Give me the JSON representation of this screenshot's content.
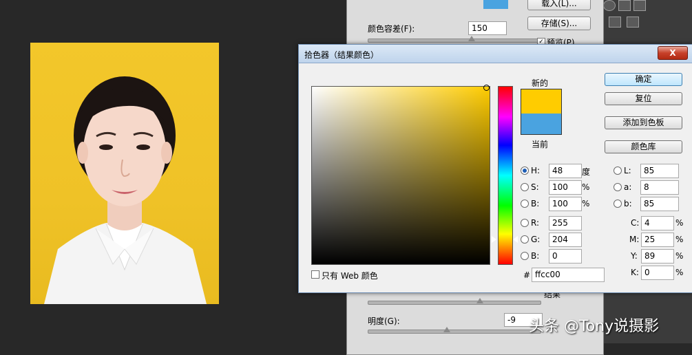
{
  "bg_panel": {
    "load_button": "载入(L)...",
    "save_button": "存储(S)...",
    "tolerance_label": "颜色容差(F):",
    "tolerance_value": "150",
    "preview_label": "预览(P)",
    "result_label": "结果",
    "lightness_label": "明度(G):",
    "lightness_value": "-9"
  },
  "dialog": {
    "title": "拾色器（结果颜色）",
    "close_label": "X",
    "new_label": "新的",
    "current_label": "当前",
    "buttons": {
      "ok": "确定",
      "reset": "复位",
      "add_swatch": "添加到色板",
      "libraries": "颜色库"
    },
    "hsb": [
      {
        "label": "H:",
        "value": "48",
        "unit": "度",
        "selected": true
      },
      {
        "label": "S:",
        "value": "100",
        "unit": "%",
        "selected": false
      },
      {
        "label": "B:",
        "value": "100",
        "unit": "%",
        "selected": false
      }
    ],
    "rgb": [
      {
        "label": "R:",
        "value": "255"
      },
      {
        "label": "G:",
        "value": "204"
      },
      {
        "label": "B:",
        "value": "0"
      }
    ],
    "lab": [
      {
        "label": "L:",
        "value": "85"
      },
      {
        "label": "a:",
        "value": "8"
      },
      {
        "label": "b:",
        "value": "85"
      }
    ],
    "cmyk": [
      {
        "label": "C:",
        "value": "4",
        "unit": "%"
      },
      {
        "label": "M:",
        "value": "25",
        "unit": "%"
      },
      {
        "label": "Y:",
        "value": "89",
        "unit": "%"
      },
      {
        "label": "K:",
        "value": "0",
        "unit": "%"
      }
    ],
    "hash": "#",
    "hex_value": "ffcc00",
    "web_only_label": "只有 Web 颜色"
  },
  "colors": {
    "new_color": "#ffcc00",
    "current_color": "#4aa3e0",
    "photo_background": "#f0c228"
  },
  "watermark": "头条 @Tony说摄影"
}
